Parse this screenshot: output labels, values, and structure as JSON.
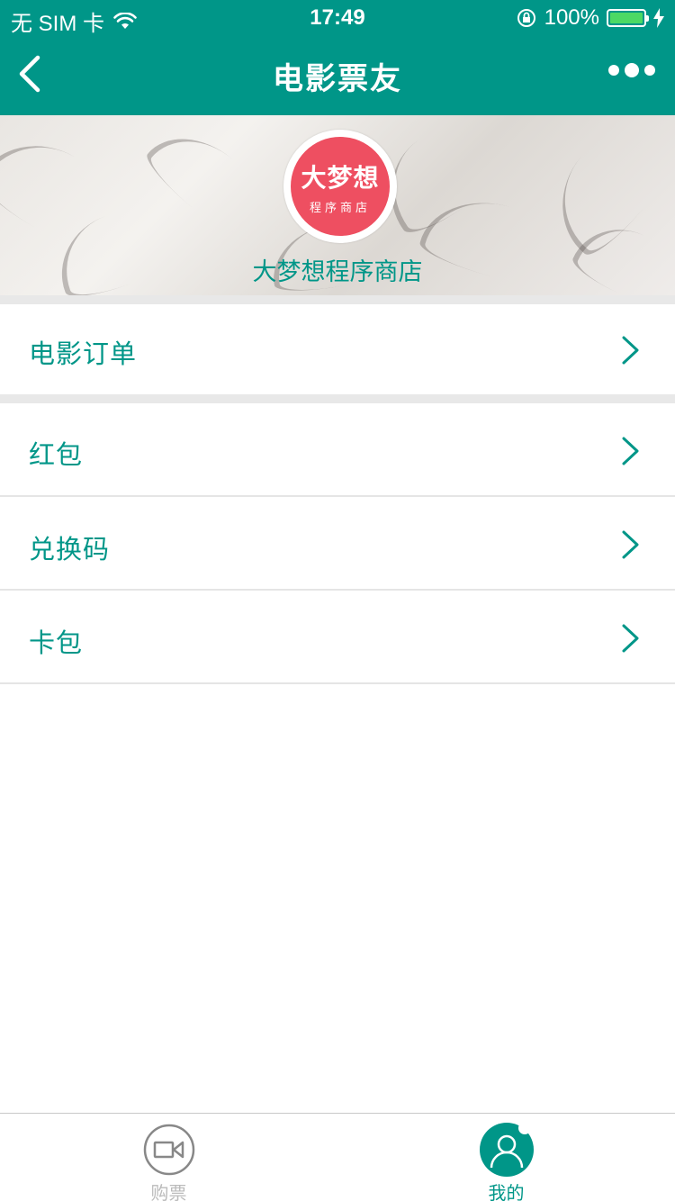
{
  "status_bar": {
    "carrier": "无 SIM 卡",
    "time": "17:49",
    "battery_percent": "100%",
    "battery_color": "#4cd964"
  },
  "nav": {
    "title": "电影票友",
    "back_icon": "chevron-left-icon",
    "more_icon": "more-dots-icon"
  },
  "profile": {
    "avatar_line1": "大梦想",
    "avatar_line2": "程序商店",
    "store_name": "大梦想程序商店",
    "avatar_color": "#ee4f61"
  },
  "menu": {
    "items": [
      {
        "label": "电影订单"
      },
      {
        "label": "红包"
      },
      {
        "label": "兑换码"
      },
      {
        "label": "卡包"
      }
    ]
  },
  "tab_bar": {
    "tabs": [
      {
        "label": "购票",
        "icon": "video-camera-icon",
        "active": false
      },
      {
        "label": "我的",
        "icon": "user-icon",
        "active": true
      }
    ]
  },
  "theme": {
    "accent": "#009688",
    "inactive": "#bbbbbb"
  }
}
